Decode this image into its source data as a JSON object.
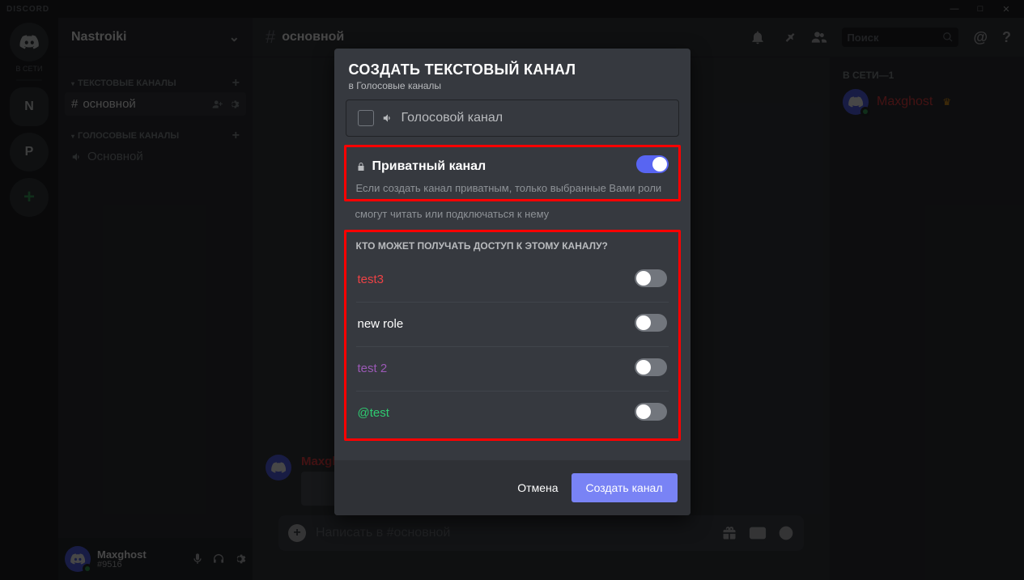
{
  "app": {
    "wordmark": "DISCORD"
  },
  "window": {
    "min": "—",
    "max": "□",
    "close": "✕"
  },
  "guilds": {
    "dm_label_online": "В СЕТИ",
    "N": "N",
    "P": "P",
    "add": "+"
  },
  "sidebar": {
    "server_name": "Nastroiki",
    "categories": [
      {
        "label": "ТЕКСТОВЫЕ КАНАЛЫ",
        "channels": [
          {
            "name": "основной",
            "type": "text",
            "active": true
          }
        ]
      },
      {
        "label": "ГОЛОСОВЫЕ КАНАЛЫ",
        "channels": [
          {
            "name": "Основной",
            "type": "voice",
            "active": false
          }
        ]
      }
    ]
  },
  "user": {
    "name": "Maxghost",
    "tag": "#9516"
  },
  "chat": {
    "channel": "основной",
    "search_placeholder": "Поиск",
    "input_placeholder": "Написать в #основной",
    "message_author": "Maxghost"
  },
  "members": {
    "heading": "В СЕТИ—1",
    "list": [
      {
        "name": "Maxghost",
        "owner": true
      }
    ]
  },
  "modal": {
    "title": "СОЗДАТЬ ТЕКСТОВЫЙ КАНАЛ",
    "subtitle": "в Голосовые каналы",
    "type_voice": "Голосовой канал",
    "private_label": "Приватный канал",
    "private_desc_line1": "Если создать канал приватным, только выбранные Вами роли",
    "private_desc_line2": "смогут читать или подключаться к нему",
    "access_title": "КТО МОЖЕТ ПОЛУЧАТЬ ДОСТУП К ЭТОМУ КАНАЛУ?",
    "roles": [
      {
        "name": "test3",
        "color": "#ed4245"
      },
      {
        "name": "new role",
        "color": "#ffffff"
      },
      {
        "name": "test 2",
        "color": "#9b59b6"
      },
      {
        "name": "@test",
        "color": "#2ecc71"
      }
    ],
    "cancel": "Отмена",
    "create": "Создать канал"
  }
}
